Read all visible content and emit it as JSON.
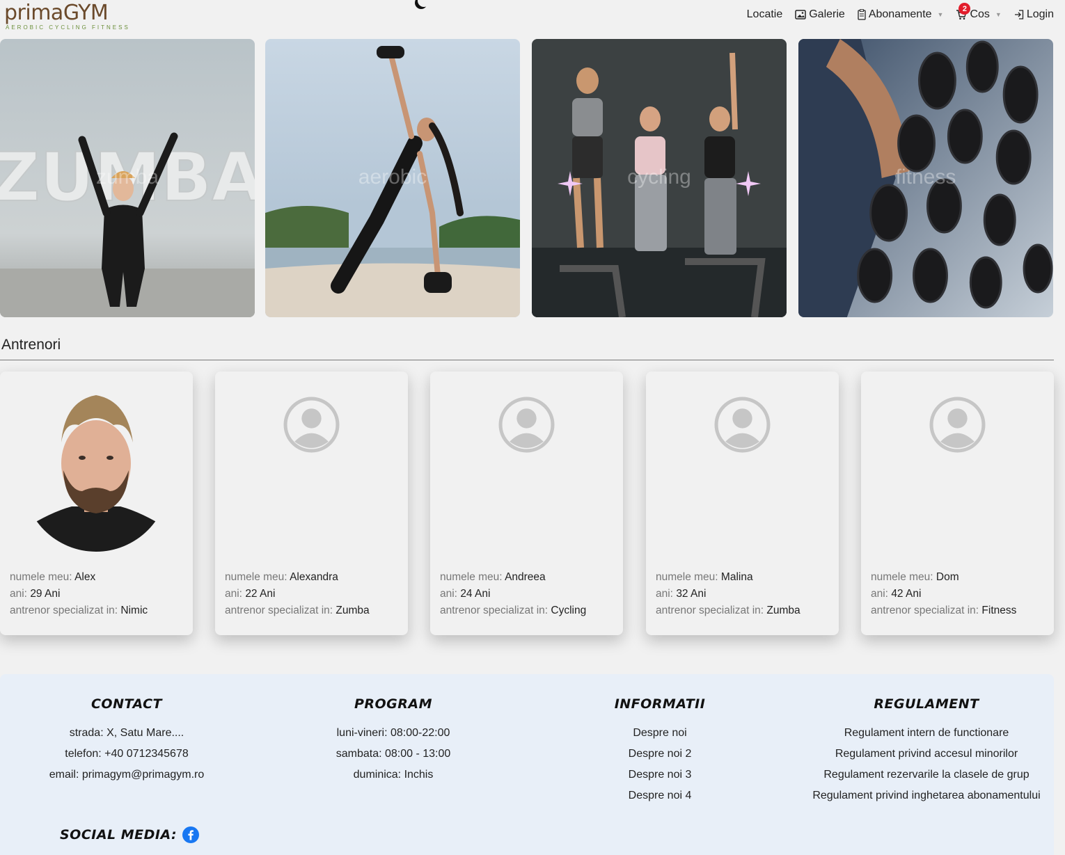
{
  "header": {
    "logo_main": "primaGYM",
    "logo_sub": "AEROBIC   CYCLING   FITNESS",
    "nav": {
      "locatie": "Locatie",
      "galerie": "Galerie",
      "abonamente": "Abonamente",
      "cos": "Cos",
      "cos_count": "2",
      "login": "Login"
    }
  },
  "gallery": [
    {
      "watermark": "zumba"
    },
    {
      "watermark": "aerobic"
    },
    {
      "watermark": "cycling"
    },
    {
      "watermark": "fitness"
    }
  ],
  "trainers": {
    "title": "Antrenori",
    "label_name": "numele meu:",
    "label_age": "ani:",
    "label_spec": "antrenor specializat in:",
    "items": [
      {
        "name": "Alex",
        "age": "29 Ani",
        "spec": "Nimic"
      },
      {
        "name": "Alexandra",
        "age": "22 Ani",
        "spec": "Zumba"
      },
      {
        "name": "Andreea",
        "age": "24 Ani",
        "spec": "Cycling"
      },
      {
        "name": "Malina",
        "age": "32 Ani",
        "spec": "Zumba"
      },
      {
        "name": "Dom",
        "age": "42 Ani",
        "spec": "Fitness"
      }
    ]
  },
  "footer": {
    "contact": {
      "title": "CONTACT",
      "lines": [
        "strada: X, Satu Mare....",
        "telefon: +40 0712345678",
        "email: primagym@primagym.ro"
      ]
    },
    "program": {
      "title": "PROGRAM",
      "lines": [
        "luni-vineri: 08:00-22:00",
        "sambata: 08:00 - 13:00",
        "duminica: Inchis"
      ]
    },
    "informatii": {
      "title": "INFORMATII",
      "lines": [
        "Despre noi",
        "Despre noi 2",
        "Despre noi 3",
        "Despre noi 4"
      ]
    },
    "regulament": {
      "title": "REGULAMENT",
      "lines": [
        "Regulament intern de functionare",
        "Regulament privind accesul minorilor",
        "Regulament rezervarile la clasele de grup",
        "Regulament privind inghetarea abonamentului"
      ]
    },
    "social_title": "SOCIAL MEDIA:"
  },
  "colors": {
    "background": "#f1f1f1",
    "footer_bg": "#e8eff8",
    "badge": "#e21d2b",
    "facebook": "#1877f2"
  }
}
